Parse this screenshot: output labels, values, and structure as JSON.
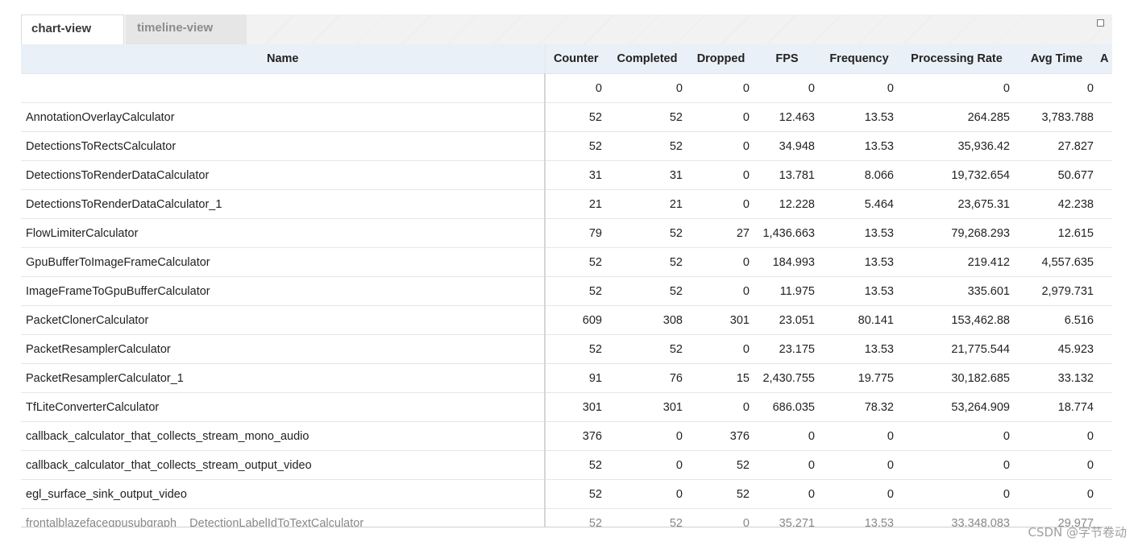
{
  "tabs": {
    "active_label": "chart-view",
    "inactive_label": "timeline-view"
  },
  "table": {
    "columns": [
      "Name",
      "Counter",
      "Completed",
      "Dropped",
      "FPS",
      "Frequency",
      "Processing Rate",
      "Avg Time",
      "A"
    ],
    "rows": [
      [
        "",
        "0",
        "0",
        "0",
        "0",
        "0",
        "0",
        "0"
      ],
      [
        "AnnotationOverlayCalculator",
        "52",
        "52",
        "0",
        "12.463",
        "13.53",
        "264.285",
        "3,783.788"
      ],
      [
        "DetectionsToRectsCalculator",
        "52",
        "52",
        "0",
        "34.948",
        "13.53",
        "35,936.42",
        "27.827"
      ],
      [
        "DetectionsToRenderDataCalculator",
        "31",
        "31",
        "0",
        "13.781",
        "8.066",
        "19,732.654",
        "50.677"
      ],
      [
        "DetectionsToRenderDataCalculator_1",
        "21",
        "21",
        "0",
        "12.228",
        "5.464",
        "23,675.31",
        "42.238"
      ],
      [
        "FlowLimiterCalculator",
        "79",
        "52",
        "27",
        "1,436.663",
        "13.53",
        "79,268.293",
        "12.615"
      ],
      [
        "GpuBufferToImageFrameCalculator",
        "52",
        "52",
        "0",
        "184.993",
        "13.53",
        "219.412",
        "4,557.635"
      ],
      [
        "ImageFrameToGpuBufferCalculator",
        "52",
        "52",
        "0",
        "11.975",
        "13.53",
        "335.601",
        "2,979.731"
      ],
      [
        "PacketClonerCalculator",
        "609",
        "308",
        "301",
        "23.051",
        "80.141",
        "153,462.88",
        "6.516"
      ],
      [
        "PacketResamplerCalculator",
        "52",
        "52",
        "0",
        "23.175",
        "13.53",
        "21,775.544",
        "45.923"
      ],
      [
        "PacketResamplerCalculator_1",
        "91",
        "76",
        "15",
        "2,430.755",
        "19.775",
        "30,182.685",
        "33.132"
      ],
      [
        "TfLiteConverterCalculator",
        "301",
        "301",
        "0",
        "686.035",
        "78.32",
        "53,264.909",
        "18.774"
      ],
      [
        "callback_calculator_that_collects_stream_mono_audio",
        "376",
        "0",
        "376",
        "0",
        "0",
        "0",
        "0"
      ],
      [
        "callback_calculator_that_collects_stream_output_video",
        "52",
        "0",
        "52",
        "0",
        "0",
        "0",
        "0"
      ],
      [
        "egl_surface_sink_output_video",
        "52",
        "0",
        "52",
        "0",
        "0",
        "0",
        "0"
      ],
      [
        "frontalblazefacegpusubgraph__DetectionLabelIdToTextCalculator",
        "52",
        "52",
        "0",
        "35.271",
        "13.53",
        "33,348.083",
        "29.977"
      ]
    ]
  },
  "watermark": "CSDN @字节卷动"
}
